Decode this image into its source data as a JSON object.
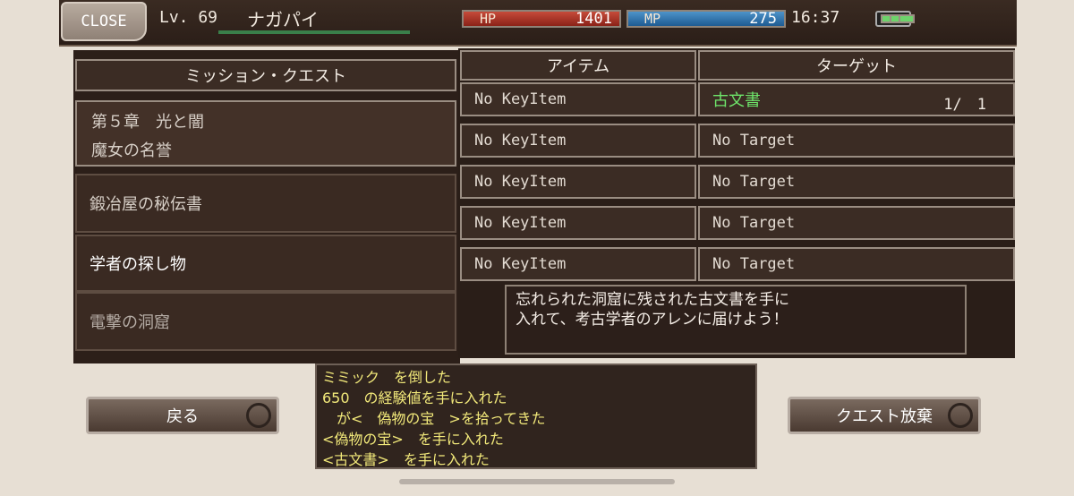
{
  "header": {
    "close_label": "CLOSE",
    "level": "Lv. 69",
    "character_name": "ナガパイ",
    "hp_label": "HP",
    "hp_value": "1401",
    "mp_label": "MP",
    "mp_value": "275",
    "time": "16:37",
    "battery_icon": "battery-icon"
  },
  "quest_list": {
    "title": "ミッション・クエスト",
    "items": [
      {
        "line1": "第５章　光と闇",
        "line2": "魔女の名誉"
      },
      {
        "line1": "鍛冶屋の秘伝書"
      },
      {
        "line1": "学者の探し物"
      },
      {
        "line1": "電撃の洞窟"
      }
    ]
  },
  "detail_table": {
    "col_item": "アイテム",
    "col_target": "ターゲット",
    "rows": [
      {
        "item": "No KeyItem",
        "target": "古文書",
        "count": "1/　1"
      },
      {
        "item": "No KeyItem",
        "target": "No Target"
      },
      {
        "item": "No KeyItem",
        "target": "No Target"
      },
      {
        "item": "No KeyItem",
        "target": "No Target"
      },
      {
        "item": "No KeyItem",
        "target": "No Target"
      }
    ],
    "description_line1": "忘れられた洞窟に残された古文書を手に",
    "description_line2": "入れて、考古学者のアレンに届けよう！"
  },
  "buttons": {
    "back": "戻る",
    "abandon": "クエスト放棄"
  },
  "log": [
    "ミミック　を倒した",
    "650　の経験値を手に入れた",
    "　が<　偽物の宝　>を拾ってきた",
    "<偽物の宝>　を手に入れた",
    "<古文書>　を手に入れた"
  ],
  "colors": {
    "hp": "#c64b3a",
    "mp": "#4d93c9",
    "target_highlight": "#6ee46a",
    "log_text": "#f2e97a"
  }
}
